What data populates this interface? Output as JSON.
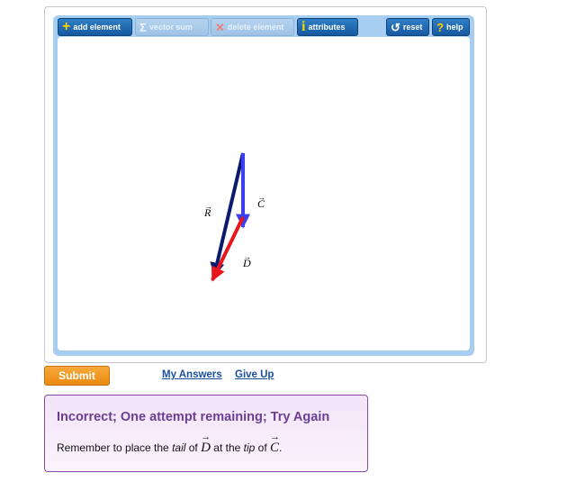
{
  "toolbar": {
    "add_element": "add element",
    "vector_sum": "vector sum",
    "delete_element": "delete element",
    "attributes": "attributes",
    "reset": "reset",
    "help": "help"
  },
  "vectors": {
    "R": "R",
    "C": "C",
    "D": "D"
  },
  "colors": {
    "R": "#0a1a6e",
    "C": "#3a3ff0",
    "D": "#e8161b",
    "accent": "#1659a0",
    "submit": "#ea8a10"
  },
  "actions": {
    "submit": "Submit",
    "my_answers": "My Answers",
    "give_up": "Give Up"
  },
  "feedback": {
    "title": "Incorrect; One attempt remaining; Try Again",
    "msg_prefix": "Remember to place the ",
    "tail": "tail",
    "of1": " of ",
    "vec1": "D",
    "at_the": " at the ",
    "tip": "tip",
    "of2": " of ",
    "vec2": "C",
    "period": "."
  }
}
